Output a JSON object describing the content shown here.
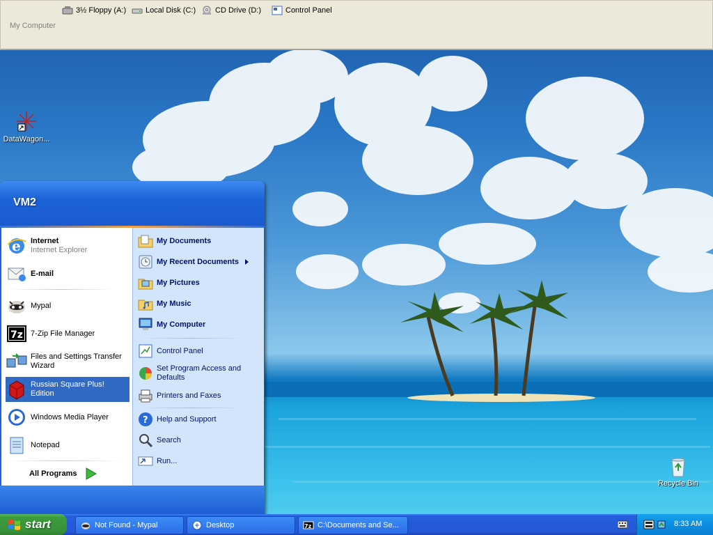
{
  "toolbar": {
    "drives": [
      {
        "label": "3½ Floppy (A:)",
        "icon": "floppy-drive-icon"
      },
      {
        "label": "Local Disk (C:)",
        "icon": "hard-disk-icon"
      },
      {
        "label": "CD Drive (D:)",
        "icon": "cd-drive-icon"
      },
      {
        "label": "Control Panel",
        "icon": "control-panel-icon"
      }
    ],
    "title": "My Computer"
  },
  "desktop": {
    "icons": [
      {
        "label": "DataWagon...",
        "icon": "datawagon-shortcut-icon"
      },
      {
        "label": "Recycle Bin",
        "icon": "recycle-bin-icon"
      }
    ]
  },
  "start_menu": {
    "user": "VM2",
    "left_items": [
      {
        "label": "Internet",
        "sublabel": "Internet Explorer",
        "icon": "internet-explorer-icon"
      },
      {
        "label": "E-mail",
        "icon": "email-icon"
      },
      {
        "label": "Mypal",
        "icon": "mypal-icon"
      },
      {
        "label": "7-Zip File Manager",
        "icon": "7zip-icon"
      },
      {
        "label": "Files and Settings Transfer Wizard",
        "icon": "transfer-wizard-icon"
      },
      {
        "label": "Russian Square Plus! Edition",
        "icon": "russian-square-icon"
      },
      {
        "label": "Windows Media Player",
        "icon": "media-player-icon"
      },
      {
        "label": "Notepad",
        "icon": "notepad-icon"
      }
    ],
    "all_programs": "All Programs",
    "right_items": [
      {
        "label": "My Documents",
        "icon": "my-documents-icon"
      },
      {
        "label": "My Recent Documents",
        "icon": "recent-documents-icon"
      },
      {
        "label": "My Pictures",
        "icon": "my-pictures-icon"
      },
      {
        "label": "My Music",
        "icon": "my-music-icon"
      },
      {
        "label": "My Computer",
        "icon": "my-computer-icon"
      },
      {
        "label": "Control Panel",
        "icon": "control-panel-icon"
      },
      {
        "label": "Set Program Access and Defaults",
        "icon": "program-access-icon"
      },
      {
        "label": "Printers and Faxes",
        "icon": "printer-icon"
      },
      {
        "label": "Help and Support",
        "icon": "help-icon"
      },
      {
        "label": "Search",
        "icon": "search-icon"
      },
      {
        "label": "Run...",
        "icon": "run-icon"
      }
    ]
  },
  "taskbar": {
    "start_label": "start",
    "tasks": [
      {
        "label": "Not Found - Mypal",
        "icon": "mypal-icon"
      },
      {
        "label": "Desktop",
        "icon": "desktop-folder-icon"
      },
      {
        "label": "C:\\Documents and Se...",
        "icon": "7zip-icon"
      }
    ],
    "clock": "8:33 AM"
  },
  "colors": {
    "taskbar_blue": "#245ddb",
    "start_green": "#3c9c3c",
    "menu_highlight": "#316ac5",
    "menu_right_panel": "#d3e5fa"
  }
}
